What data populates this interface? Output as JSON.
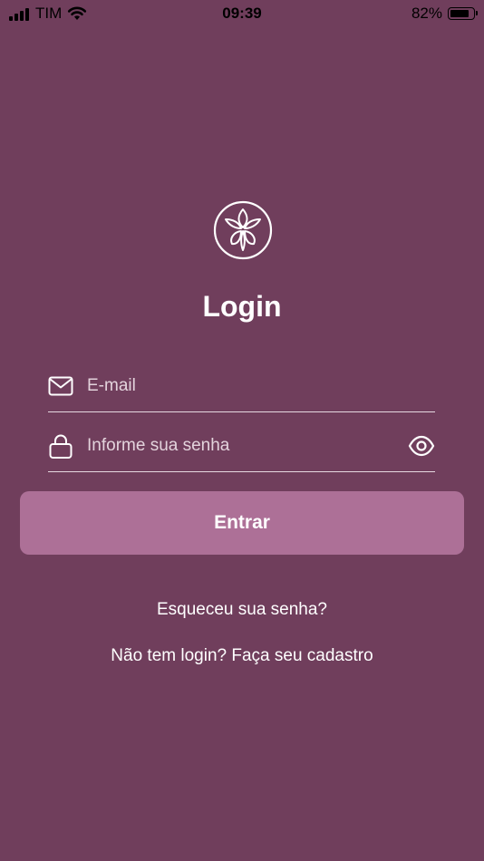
{
  "status_bar": {
    "carrier": "TIM",
    "time": "09:39",
    "battery": "82%",
    "battery_level": 0.82
  },
  "logo": {
    "icon": "flower-logo-icon"
  },
  "title": "Login",
  "email": {
    "placeholder": "E-mail",
    "value": "",
    "icon": "mail-icon"
  },
  "password": {
    "placeholder": "Informe sua senha",
    "value": "",
    "icon": "lock-icon",
    "toggle_icon": "eye-icon"
  },
  "enter_button": "Entrar",
  "forgot_link": "Esqueceu sua senha?",
  "signup_link": "Não tem login? Faça seu cadastro",
  "colors": {
    "background": "#703e5c",
    "button": "#ad7097",
    "text": "#ffffff"
  }
}
